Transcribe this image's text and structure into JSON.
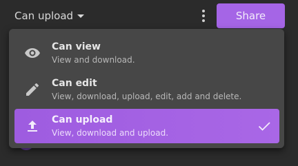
{
  "toolbar": {
    "permission_label": "Can upload",
    "share_label": "Share",
    "more_icon": "vertical-dots-icon",
    "caret_icon": "caret-down-icon"
  },
  "menu": {
    "items": [
      {
        "icon": "eye-icon",
        "title": "Can view",
        "description": "View and download."
      },
      {
        "icon": "pencil-icon",
        "title": "Can edit",
        "description": "View, download, upload, edit, add and delete."
      },
      {
        "icon": "upload-icon",
        "title": "Can upload",
        "description": "View, download and upload.",
        "selected": true
      }
    ],
    "selected_icon": "checkmark-icon"
  },
  "colors": {
    "accent": "#a565e6",
    "background": "#2b2b2b",
    "menu_bg": "#474747"
  }
}
